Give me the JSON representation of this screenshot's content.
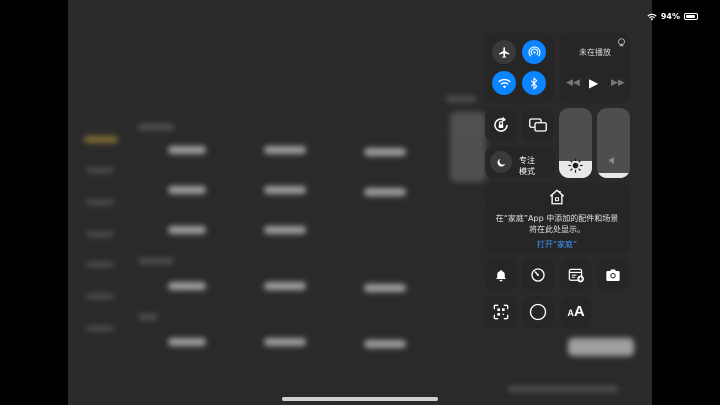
{
  "status_bar": {
    "battery_text": "94%",
    "battery_level": 0.94
  },
  "now_playing": {
    "title": "未在播放"
  },
  "focus": {
    "line1": "专注",
    "line2": "模式"
  },
  "home": {
    "message_line1": "在“家庭”App 中添加的配件和场景",
    "message_line2": "将在此处显示。",
    "link": "打开“家庭”"
  },
  "brightness": {
    "level": 0.25
  },
  "volume": {
    "level": 0.07
  },
  "text_size": {
    "label": "A"
  },
  "colors": {
    "accent": "#0a84ff",
    "link": "#3b9bff",
    "tile": "#262628"
  }
}
